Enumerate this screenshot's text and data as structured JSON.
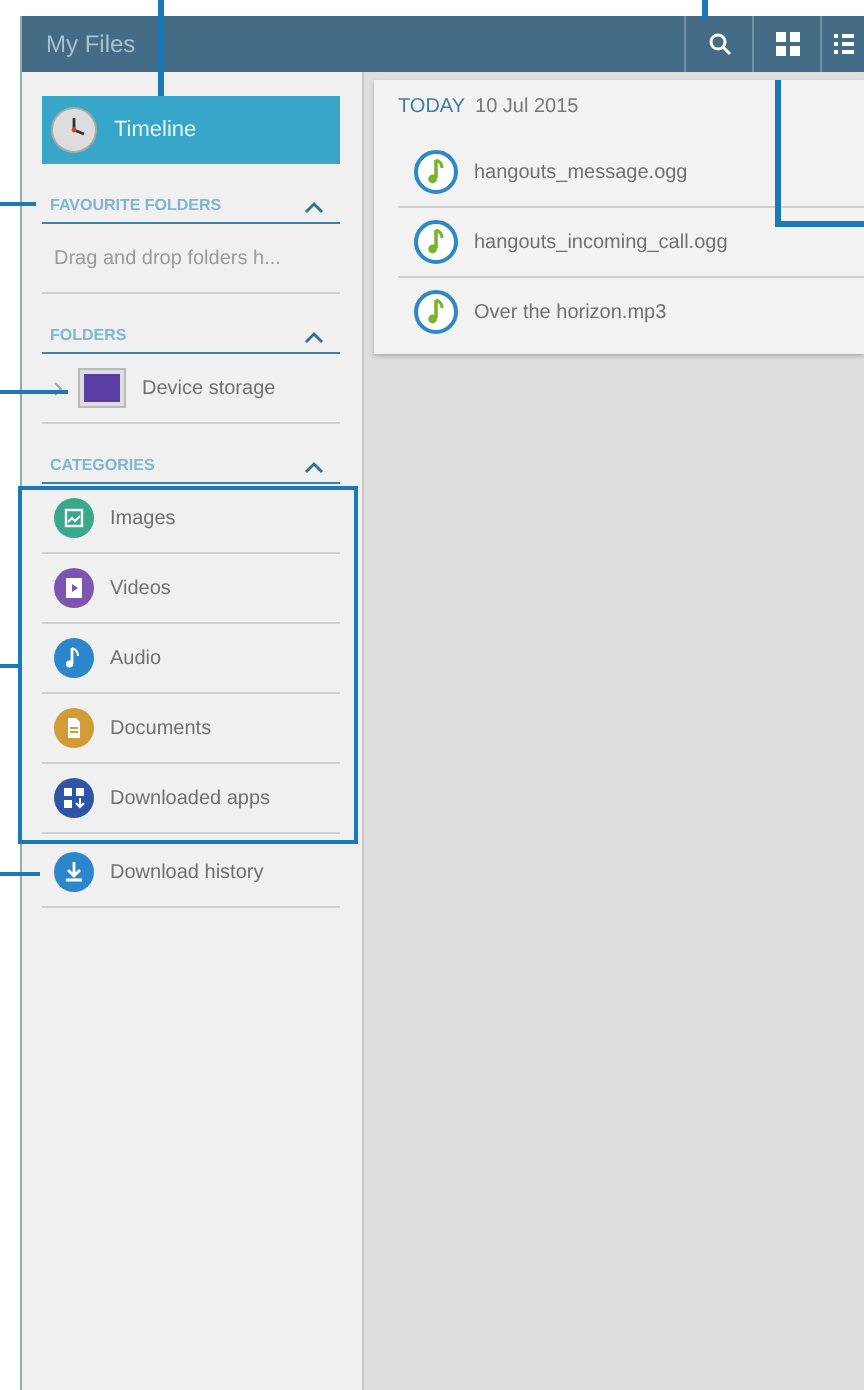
{
  "app_bar": {
    "title": "My Files"
  },
  "sidebar": {
    "timeline": {
      "label": "Timeline",
      "selected": true
    },
    "sections": [
      {
        "title": "FAVOURITE FOLDERS",
        "expanded": true,
        "items": [
          {
            "kind": "hint",
            "label": "Drag and drop folders h..."
          }
        ]
      },
      {
        "title": "FOLDERS",
        "expanded": true,
        "items": [
          {
            "kind": "folder",
            "label": "Device storage"
          }
        ]
      },
      {
        "title": "CATEGORIES",
        "expanded": true,
        "items": [
          {
            "kind": "image",
            "label": "Images"
          },
          {
            "kind": "video",
            "label": "Videos"
          },
          {
            "kind": "audio",
            "label": "Audio"
          },
          {
            "kind": "document",
            "label": "Documents"
          },
          {
            "kind": "apps",
            "label": "Downloaded apps"
          }
        ]
      }
    ],
    "download_history": {
      "label": "Download history"
    }
  },
  "main": {
    "group": {
      "label": "TODAY",
      "date": "10 Jul 2015"
    },
    "files": [
      {
        "name": "hangouts_message.ogg"
      },
      {
        "name": "hangouts_incoming_call.ogg"
      },
      {
        "name": "Over the horizon.mp3"
      }
    ]
  }
}
